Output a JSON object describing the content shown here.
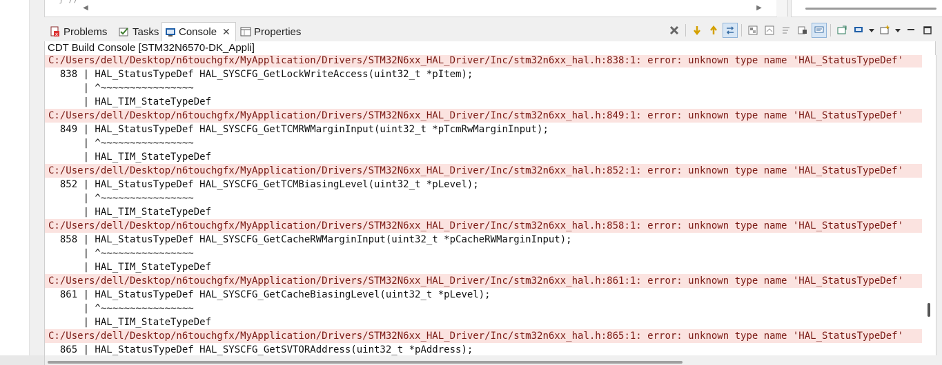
{
  "editor": {
    "visible_code": "} //"
  },
  "tabs": [
    {
      "label": "Problems",
      "icon": "problems-icon"
    },
    {
      "label": "Tasks",
      "icon": "tasks-icon"
    },
    {
      "label": "Console",
      "icon": "console-icon",
      "active": true
    },
    {
      "label": "Properties",
      "icon": "properties-icon"
    }
  ],
  "console": {
    "title": "CDT Build Console [STM32N6570-DK_Appli]",
    "lines": [
      {
        "type": "err",
        "text": "C:/Users/dell/Desktop/n6touchgfx/MyApplication/Drivers/STM32N6xx_HAL_Driver/Inc/stm32n6xx_hal.h:838:1: error: unknown type name 'HAL_StatusTypeDef'"
      },
      {
        "type": "code",
        "text": "  838 | HAL_StatusTypeDef HAL_SYSCFG_GetLockWriteAccess(uint32_t *pItem);"
      },
      {
        "type": "code",
        "text": "      | ^~~~~~~~~~~~~~~~~"
      },
      {
        "type": "code",
        "text": "      | HAL_TIM_StateTypeDef"
      },
      {
        "type": "err",
        "text": "C:/Users/dell/Desktop/n6touchgfx/MyApplication/Drivers/STM32N6xx_HAL_Driver/Inc/stm32n6xx_hal.h:849:1: error: unknown type name 'HAL_StatusTypeDef'"
      },
      {
        "type": "code",
        "text": "  849 | HAL_StatusTypeDef HAL_SYSCFG_GetTCMRWMarginInput(uint32_t *pTcmRwMarginInput);"
      },
      {
        "type": "code",
        "text": "      | ^~~~~~~~~~~~~~~~~"
      },
      {
        "type": "code",
        "text": "      | HAL_TIM_StateTypeDef"
      },
      {
        "type": "err",
        "text": "C:/Users/dell/Desktop/n6touchgfx/MyApplication/Drivers/STM32N6xx_HAL_Driver/Inc/stm32n6xx_hal.h:852:1: error: unknown type name 'HAL_StatusTypeDef'"
      },
      {
        "type": "code",
        "text": "  852 | HAL_StatusTypeDef HAL_SYSCFG_GetTCMBiasingLevel(uint32_t *pLevel);"
      },
      {
        "type": "code",
        "text": "      | ^~~~~~~~~~~~~~~~~"
      },
      {
        "type": "code",
        "text": "      | HAL_TIM_StateTypeDef"
      },
      {
        "type": "err",
        "text": "C:/Users/dell/Desktop/n6touchgfx/MyApplication/Drivers/STM32N6xx_HAL_Driver/Inc/stm32n6xx_hal.h:858:1: error: unknown type name 'HAL_StatusTypeDef'"
      },
      {
        "type": "code",
        "text": "  858 | HAL_StatusTypeDef HAL_SYSCFG_GetCacheRWMarginInput(uint32_t *pCacheRWMarginInput);"
      },
      {
        "type": "code",
        "text": "      | ^~~~~~~~~~~~~~~~~"
      },
      {
        "type": "code",
        "text": "      | HAL_TIM_StateTypeDef"
      },
      {
        "type": "err",
        "text": "C:/Users/dell/Desktop/n6touchgfx/MyApplication/Drivers/STM32N6xx_HAL_Driver/Inc/stm32n6xx_hal.h:861:1: error: unknown type name 'HAL_StatusTypeDef'"
      },
      {
        "type": "code",
        "text": "  861 | HAL_StatusTypeDef HAL_SYSCFG_GetCacheBiasingLevel(uint32_t *pLevel);"
      },
      {
        "type": "code",
        "text": "      | ^~~~~~~~~~~~~~~~~"
      },
      {
        "type": "code",
        "text": "      | HAL_TIM_StateTypeDef"
      },
      {
        "type": "err",
        "text": "C:/Users/dell/Desktop/n6touchgfx/MyApplication/Drivers/STM32N6xx_HAL_Driver/Inc/stm32n6xx_hal.h:865:1: error: unknown type name 'HAL_StatusTypeDef'"
      },
      {
        "type": "code",
        "text": "  865 | HAL_StatusTypeDef HAL_SYSCFG_GetSVTORAddress(uint32_t *pAddress);"
      }
    ]
  },
  "toolbar_icons": [
    "terminate-icon",
    "next-problem-icon",
    "previous-problem-icon",
    "link-console-icon",
    "scroll-lock-icon",
    "clear-console-icon",
    "word-wrap-icon",
    "pin-console-icon",
    "display-selected-console-icon",
    "open-console-icon",
    "minimize-icon",
    "maximize-icon"
  ],
  "colors": {
    "error_bg": "#fbe3e0",
    "error_fg": "#7a1a14",
    "accent": "#1f5fa8"
  }
}
